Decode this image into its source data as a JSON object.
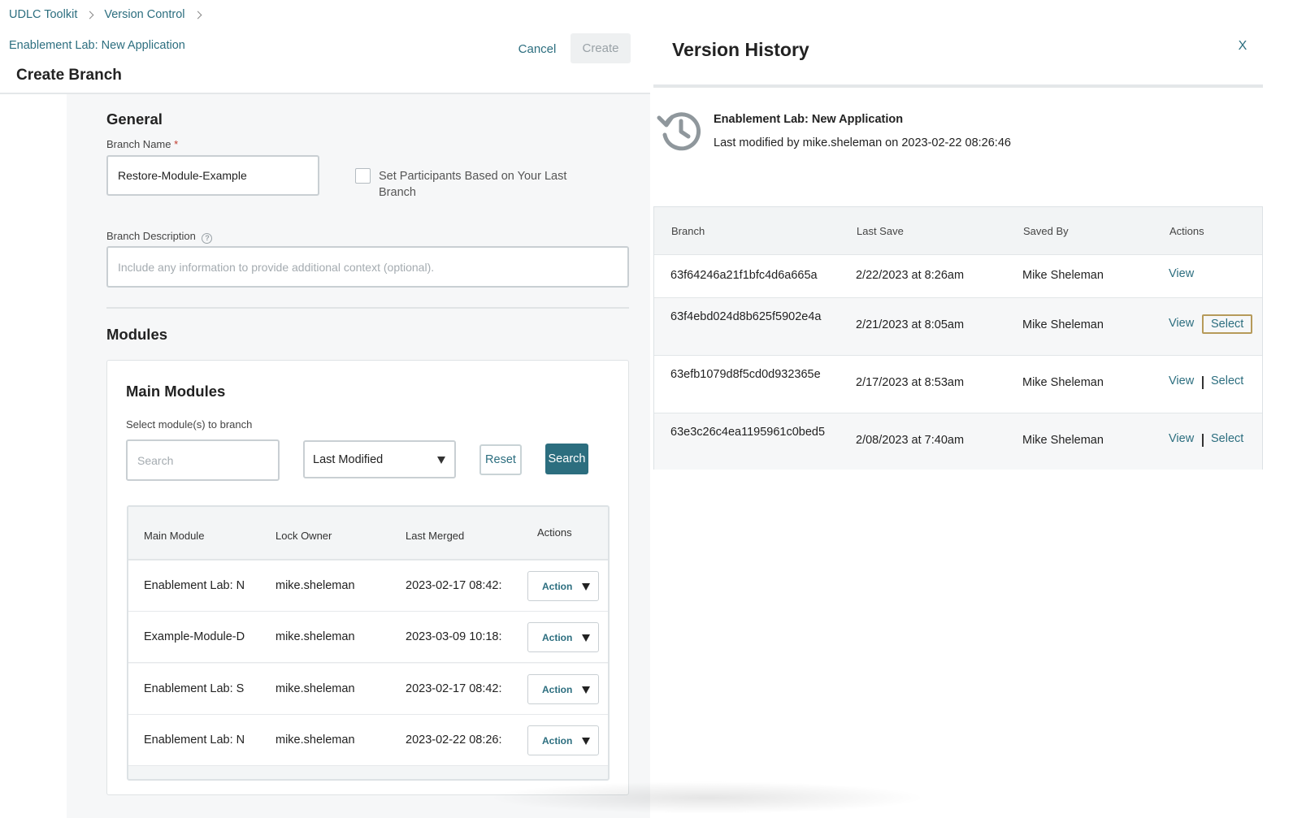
{
  "breadcrumb": {
    "items": [
      "UDLC Toolkit",
      "Version Control"
    ]
  },
  "header": {
    "app_link": "Enablement Lab: New Application",
    "page_title": "Create Branch",
    "cancel_label": "Cancel",
    "create_label": "Create"
  },
  "general": {
    "title": "General",
    "branch_name_label": "Branch Name",
    "required_mark": "*",
    "branch_name_value": "Restore-Module-Example",
    "participants_label": "Set Participants Based on Your Last Branch",
    "participants_checked": false,
    "description_label": "Branch Description",
    "description_placeholder": "Include any information to provide additional context (optional).",
    "help_glyph": "?"
  },
  "modules": {
    "title": "Modules",
    "main_title": "Main Modules",
    "select_hint": "Select module(s) to branch",
    "search_placeholder": "Search",
    "sort_value": "Last Modified",
    "reset_label": "Reset",
    "search_label": "Search",
    "columns": [
      "Main Module",
      "Lock Owner",
      "Last Merged",
      "Actions"
    ],
    "rows": [
      {
        "module": "Enablement Lab: N",
        "owner": "mike.sheleman",
        "merged": "2023-02-17 08:42:",
        "action": "Action"
      },
      {
        "module": "Example-Module-D",
        "owner": "mike.sheleman",
        "merged": "2023-03-09 10:18:",
        "action": "Action"
      },
      {
        "module": "Enablement Lab: S",
        "owner": "mike.sheleman",
        "merged": "2023-02-17 08:42:",
        "action": "Action"
      },
      {
        "module": "Enablement Lab: N",
        "owner": "mike.sheleman",
        "merged": "2023-02-22 08:26:",
        "action": "Action"
      }
    ]
  },
  "version_history": {
    "title": "Version History",
    "close_label": "X",
    "app_name": "Enablement Lab: New Application",
    "modified_text": "Last modified by mike.sheleman on 2023-02-22 08:26:46",
    "icon": "history-icon",
    "columns": [
      "Branch",
      "Last Save",
      "Saved By",
      "Actions"
    ],
    "rows": [
      {
        "branch": "63f64246a21f1bfc4d6a665a",
        "last_save": "2/22/2023 at 8:26am",
        "saved_by": "Mike Sheleman",
        "view": "View",
        "select": null
      },
      {
        "branch": "63f4ebd024d8b625f5902e4a",
        "last_save": "2/21/2023 at 8:05am",
        "saved_by": "Mike Sheleman",
        "view": "View",
        "select": "Select"
      },
      {
        "branch": "63efb1079d8f5cd0d932365e",
        "last_save": "2/17/2023 at 8:53am",
        "saved_by": "Mike Sheleman",
        "view": "View",
        "select": "Select"
      },
      {
        "branch": "63e3c26c4ea1195961c0bed5",
        "last_save": "2/08/2023 at 7:40am",
        "saved_by": "Mike Sheleman",
        "view": "View",
        "select": "Select"
      }
    ]
  },
  "colors": {
    "accent": "#2c6e7f",
    "focus_outline": "#b69a5a",
    "required": "#c0392b"
  }
}
